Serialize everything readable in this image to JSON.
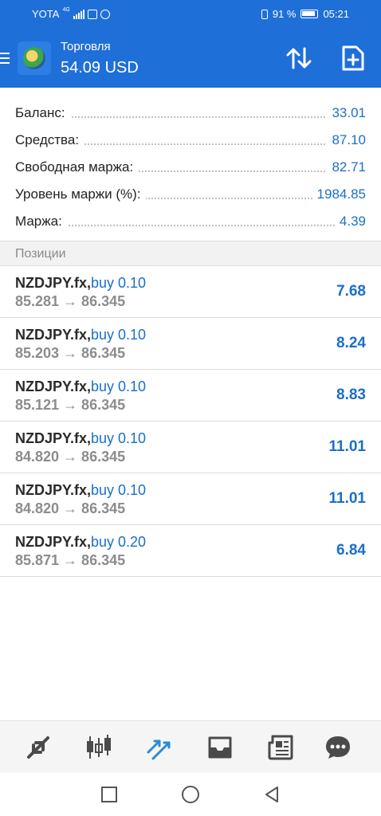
{
  "status_bar": {
    "carrier": "YOTA",
    "network": "4G",
    "battery_percent": "91 %",
    "time": "05:21"
  },
  "header": {
    "title": "Торговля",
    "amount": "54.09 USD",
    "icons": [
      "menu-icon",
      "metatrader-logo",
      "sort-icon",
      "new-order-icon"
    ]
  },
  "summary": [
    {
      "label": "Баланс:",
      "value": "33.01"
    },
    {
      "label": "Средства:",
      "value": "87.10"
    },
    {
      "label": "Свободная маржа:",
      "value": "82.71"
    },
    {
      "label": "Уровень маржи (%):",
      "value": "1984.85"
    },
    {
      "label": "Маржа:",
      "value": "4.39"
    }
  ],
  "positions_header": "Позиции",
  "positions": [
    {
      "symbol": "NZDJPY.fx,",
      "type": "buy 0.10",
      "prices": "85.281 → 86.345",
      "profit": "7.68"
    },
    {
      "symbol": "NZDJPY.fx,",
      "type": "buy 0.10",
      "prices": "85.203 → 86.345",
      "profit": "8.24"
    },
    {
      "symbol": "NZDJPY.fx,",
      "type": "buy 0.10",
      "prices": "85.121 → 86.345",
      "profit": "8.83"
    },
    {
      "symbol": "NZDJPY.fx,",
      "type": "buy 0.10",
      "prices": "84.820 → 86.345",
      "profit": "11.01"
    },
    {
      "symbol": "NZDJPY.fx,",
      "type": "buy 0.10",
      "prices": "84.820 → 86.345",
      "profit": "11.01"
    },
    {
      "symbol": "NZDJPY.fx,",
      "type": "buy 0.20",
      "prices": "85.871 → 86.345",
      "profit": "6.84"
    }
  ],
  "tabbar": {
    "tabs": [
      "quotes-icon",
      "chart-icon",
      "trade-icon",
      "history-icon",
      "news-icon",
      "chat-icon"
    ],
    "active": "trade-icon",
    "active_color": "#2a8ad8",
    "inactive_color": "#4a4a4a"
  },
  "colors": {
    "header_bg": "#1f6fd8",
    "value_blue": "#1a6fc9"
  }
}
